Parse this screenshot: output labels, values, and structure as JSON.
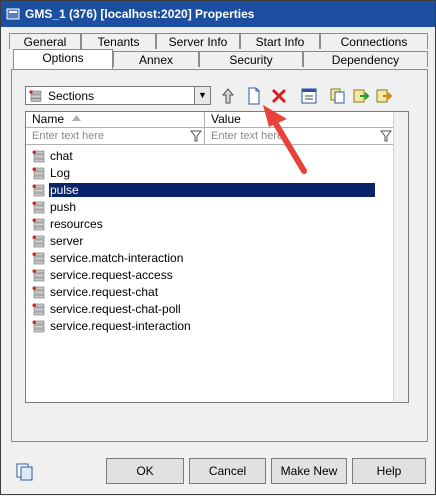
{
  "window": {
    "title": "GMS_1 (376) [localhost:2020] Properties",
    "title_bar_color": "#1c4fa0"
  },
  "tabs": {
    "row_back": [
      "General",
      "Tenants",
      "Server Info",
      "Start Info",
      "Connections"
    ],
    "row_front": [
      "Options",
      "Annex",
      "Security",
      "Dependency"
    ],
    "active": "Options"
  },
  "section_combo": {
    "value": "Sections"
  },
  "toolbar": {
    "icons": [
      "up-level-icon",
      "new-document-icon",
      "delete-icon",
      "edit-icon",
      "copy-icon",
      "import-icon",
      "export-icon"
    ]
  },
  "grid": {
    "columns": [
      "Name",
      "Value"
    ],
    "filter_placeholder": "Enter text here",
    "selected_index": 2,
    "rows": [
      "chat",
      "Log",
      "pulse",
      "push",
      "resources",
      "server",
      "service.match-interaction",
      "service.request-access",
      "service.request-chat",
      "service.request-chat-poll",
      "service.request-interaction"
    ]
  },
  "buttons": {
    "ok": "OK",
    "cancel": "Cancel",
    "make_new": "Make New",
    "help": "Help"
  },
  "annotation": {
    "arrow_color": "#e8423a"
  }
}
